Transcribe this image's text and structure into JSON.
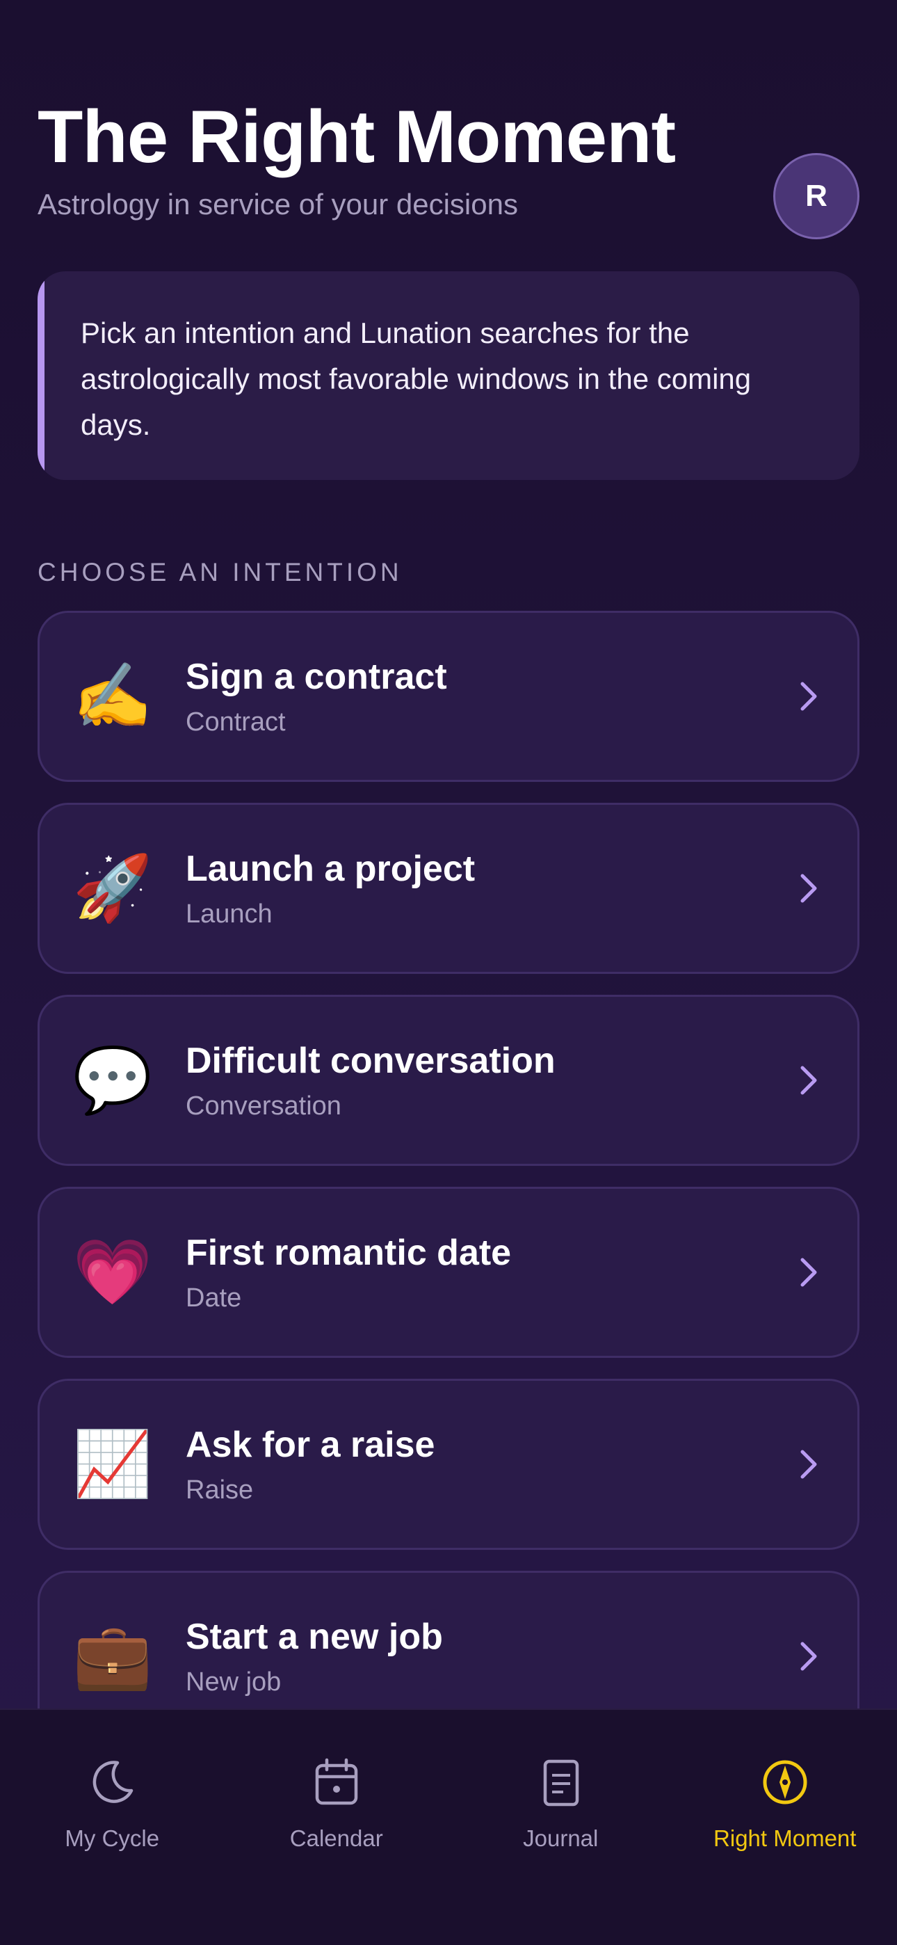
{
  "header": {
    "title": "The Right Moment",
    "subtitle": "Astrology in service of your decisions",
    "avatar_initial": "R"
  },
  "intro": {
    "text": "Pick an intention and Lunation searches for the astrologically most favorable windows in the coming days."
  },
  "section_label": "CHOOSE AN INTENTION",
  "intentions": [
    {
      "emoji": "✍️",
      "title": "Sign a contract",
      "subtitle": "Contract"
    },
    {
      "emoji": "🚀",
      "title": "Launch a project",
      "subtitle": "Launch"
    },
    {
      "emoji": "💬",
      "title": "Difficult conversation",
      "subtitle": "Conversation"
    },
    {
      "emoji": "💗",
      "title": "First romantic date",
      "subtitle": "Date"
    },
    {
      "emoji": "📈",
      "title": "Ask for a raise",
      "subtitle": "Raise"
    },
    {
      "emoji": "💼",
      "title": "Start a new job",
      "subtitle": "New job"
    }
  ],
  "tabbar": {
    "tabs": [
      {
        "label": "My Cycle",
        "icon": "moon-icon"
      },
      {
        "label": "Calendar",
        "icon": "calendar-icon"
      },
      {
        "label": "Journal",
        "icon": "journal-icon"
      },
      {
        "label": "Right Moment",
        "icon": "compass-icon",
        "active": true
      }
    ]
  },
  "colors": {
    "accent": "#f2c811",
    "intro_bar": "#b797f0",
    "chevron": "#b99bf2"
  }
}
